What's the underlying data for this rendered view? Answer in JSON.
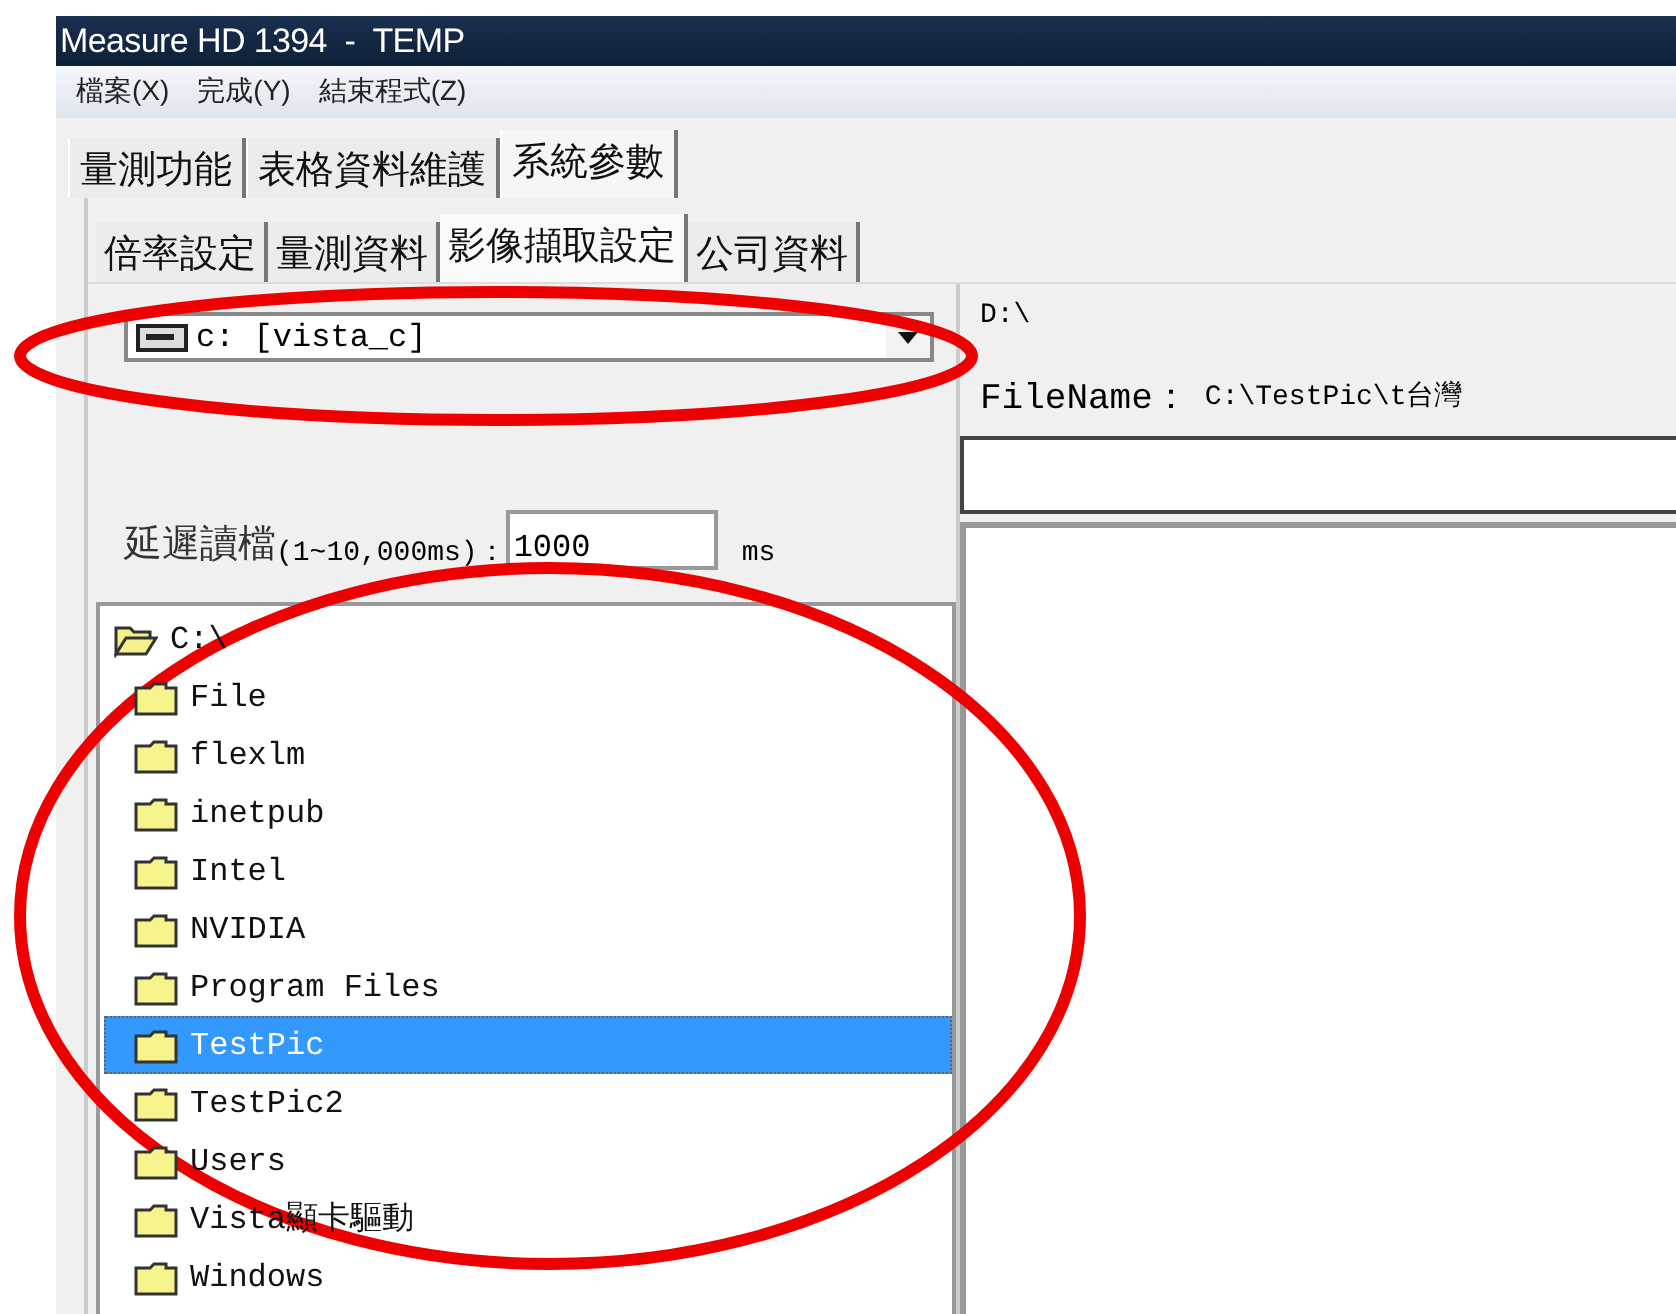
{
  "window": {
    "title": "Measure HD 1394  -  TEMP"
  },
  "menu": [
    "檔案(X)",
    "完成(Y)",
    "結束程式(Z)"
  ],
  "tabs": [
    {
      "label": "量測功能",
      "selected": false
    },
    {
      "label": "表格資料維護",
      "selected": false
    },
    {
      "label": "系統參數",
      "selected": true
    }
  ],
  "subtabs": [
    {
      "label": "倍率設定",
      "selected": false
    },
    {
      "label": "量測資料",
      "selected": false
    },
    {
      "label": "影像擷取設定",
      "selected": true
    },
    {
      "label": "公司資料",
      "selected": false
    }
  ],
  "drive_select": {
    "value": "c: [vista_c]"
  },
  "delay": {
    "label": "延遲讀檔",
    "range": "(1~10,000ms)：",
    "value": "1000",
    "unit": "ms"
  },
  "folder_tree": {
    "root": "C:\\",
    "items": [
      {
        "label": "File",
        "selected": false
      },
      {
        "label": "flexlm",
        "selected": false
      },
      {
        "label": "inetpub",
        "selected": false
      },
      {
        "label": "Intel",
        "selected": false
      },
      {
        "label": "NVIDIA",
        "selected": false
      },
      {
        "label": "Program Files",
        "selected": false
      },
      {
        "label": "TestPic",
        "selected": true
      },
      {
        "label": "TestPic2",
        "selected": false
      },
      {
        "label": "Users",
        "selected": false
      },
      {
        "label": "Vista顯卡驅動",
        "selected": false
      },
      {
        "label": "Windows",
        "selected": false
      }
    ]
  },
  "right_panel": {
    "path": "D:\\",
    "filename_label": "FileName：",
    "filename_value": "C:\\TestPic\\t台灣"
  }
}
